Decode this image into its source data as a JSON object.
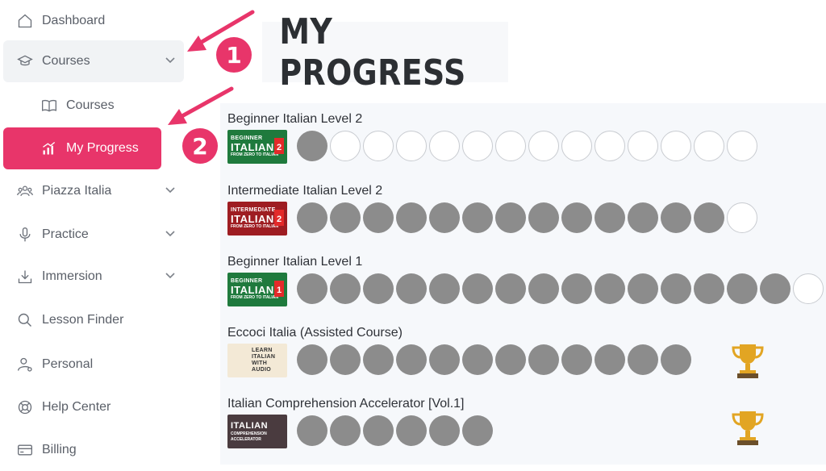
{
  "sidebar": {
    "items": [
      {
        "label": "Dashboard",
        "icon": "home-icon"
      },
      {
        "label": "Courses",
        "icon": "graduation-cap-icon",
        "expanded": true
      },
      {
        "label": "Courses",
        "icon": "book-icon"
      },
      {
        "label": "My Progress",
        "icon": "bar-chart-icon",
        "active": true
      },
      {
        "label": "Piazza Italia",
        "icon": "community-icon"
      },
      {
        "label": "Practice",
        "icon": "microphone-icon"
      },
      {
        "label": "Immersion",
        "icon": "download-icon"
      },
      {
        "label": "Lesson Finder",
        "icon": "search-icon"
      },
      {
        "label": "Personal",
        "icon": "user-settings-icon"
      },
      {
        "label": "Help Center",
        "icon": "lifebuoy-icon"
      },
      {
        "label": "Billing",
        "icon": "credit-card-icon"
      }
    ]
  },
  "page": {
    "title": "MY PROGRESS"
  },
  "annotations": {
    "step1": "1",
    "step2": "2"
  },
  "colors": {
    "accent": "#e8356a",
    "completed": "#8c8c8c",
    "pending": "#ffffff",
    "trophy": "#e2a523"
  },
  "courses": [
    {
      "title": "Beginner Italian Level 2",
      "thumb": {
        "line1": "BEGINNER",
        "line2": "ITALIAN",
        "line3": "FROM ZERO TO ITALIAN",
        "level": "2",
        "style": "green"
      },
      "completed": 1,
      "total": 14,
      "trophy": false
    },
    {
      "title": "Intermediate Italian Level 2",
      "thumb": {
        "line1": "INTERMEDIATE",
        "line2": "ITALIAN",
        "line3": "FROM ZERO TO ITALIAN",
        "level": "2",
        "style": "red"
      },
      "completed": 13,
      "total": 14,
      "trophy": false
    },
    {
      "title": "Beginner Italian Level 1",
      "thumb": {
        "line1": "BEGINNER",
        "line2": "ITALIAN",
        "line3": "FROM ZERO TO ITALIAN",
        "level": "1",
        "style": "green"
      },
      "completed": 15,
      "total": 16,
      "trophy": false
    },
    {
      "title": "Eccoci Italia (Assisted Course)",
      "thumb": {
        "line1": "LEARN ITALIAN",
        "line2": "WITH AUDIO",
        "line3": "",
        "level": "",
        "style": "photo"
      },
      "completed": 12,
      "total": 12,
      "trophy": true
    },
    {
      "title": "Italian Comprehension Accelerator [Vol.1]",
      "thumb": {
        "line1": "",
        "line2": "ITALIAN",
        "line3": "COMPREHENSION ACCELERATOR",
        "level": "",
        "style": "dark"
      },
      "completed": 6,
      "total": 6,
      "trophy": true
    }
  ]
}
